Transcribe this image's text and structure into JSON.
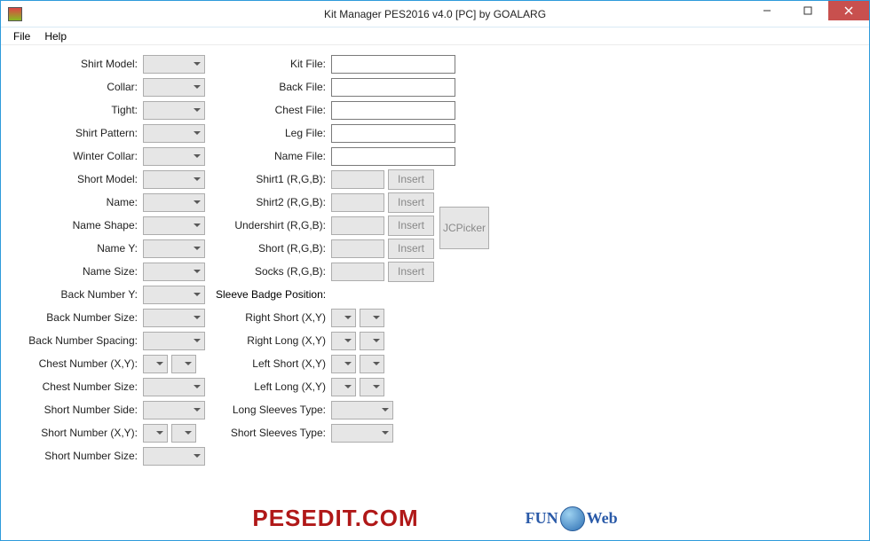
{
  "window": {
    "title": "Kit Manager PES2016 v4.0 [PC] by GOALARG"
  },
  "menu": {
    "file": "File",
    "help": "Help"
  },
  "left": {
    "shirt_model": "Shirt Model:",
    "collar": "Collar:",
    "tight": "Tight:",
    "shirt_pattern": "Shirt Pattern:",
    "winter_collar": "Winter Collar:",
    "short_model": "Short Model:",
    "name": "Name:",
    "name_shape": "Name Shape:",
    "name_y": "Name Y:",
    "name_size": "Name Size:",
    "back_number_y": "Back Number Y:",
    "back_number_size": "Back Number Size:",
    "back_number_spacing": "Back Number Spacing:",
    "chest_number_xy": "Chest Number (X,Y):",
    "chest_number_size": "Chest Number Size:",
    "short_number_side": "Short Number Side:",
    "short_number_xy": "Short Number (X,Y):",
    "short_number_size": "Short Number Size:"
  },
  "right": {
    "kit_file": "Kit File:",
    "back_file": "Back File:",
    "chest_file": "Chest File:",
    "leg_file": "Leg File:",
    "name_file": "Name File:",
    "shirt1_rgb": "Shirt1 (R,G,B):",
    "shirt2_rgb": "Shirt2 (R,G,B):",
    "undershirt_rgb": "Undershirt (R,G,B):",
    "short_rgb": "Short (R,G,B):",
    "socks_rgb": "Socks (R,G,B):",
    "sleeve_badge": "Sleeve Badge Position:",
    "right_short_xy": "Right Short (X,Y)",
    "right_long_xy": "Right Long (X,Y)",
    "left_short_xy": "Left Short (X,Y)",
    "left_long_xy": "Left Long (X,Y)",
    "long_sleeves_type": "Long Sleeves Type:",
    "short_sleeves_type": "Short Sleeves Type:"
  },
  "buttons": {
    "insert": "Insert",
    "jcpicker": "JCPicker"
  },
  "logos": {
    "pesedit": "PESEDIT.COM",
    "fun": "FUN",
    "web": "Web"
  }
}
